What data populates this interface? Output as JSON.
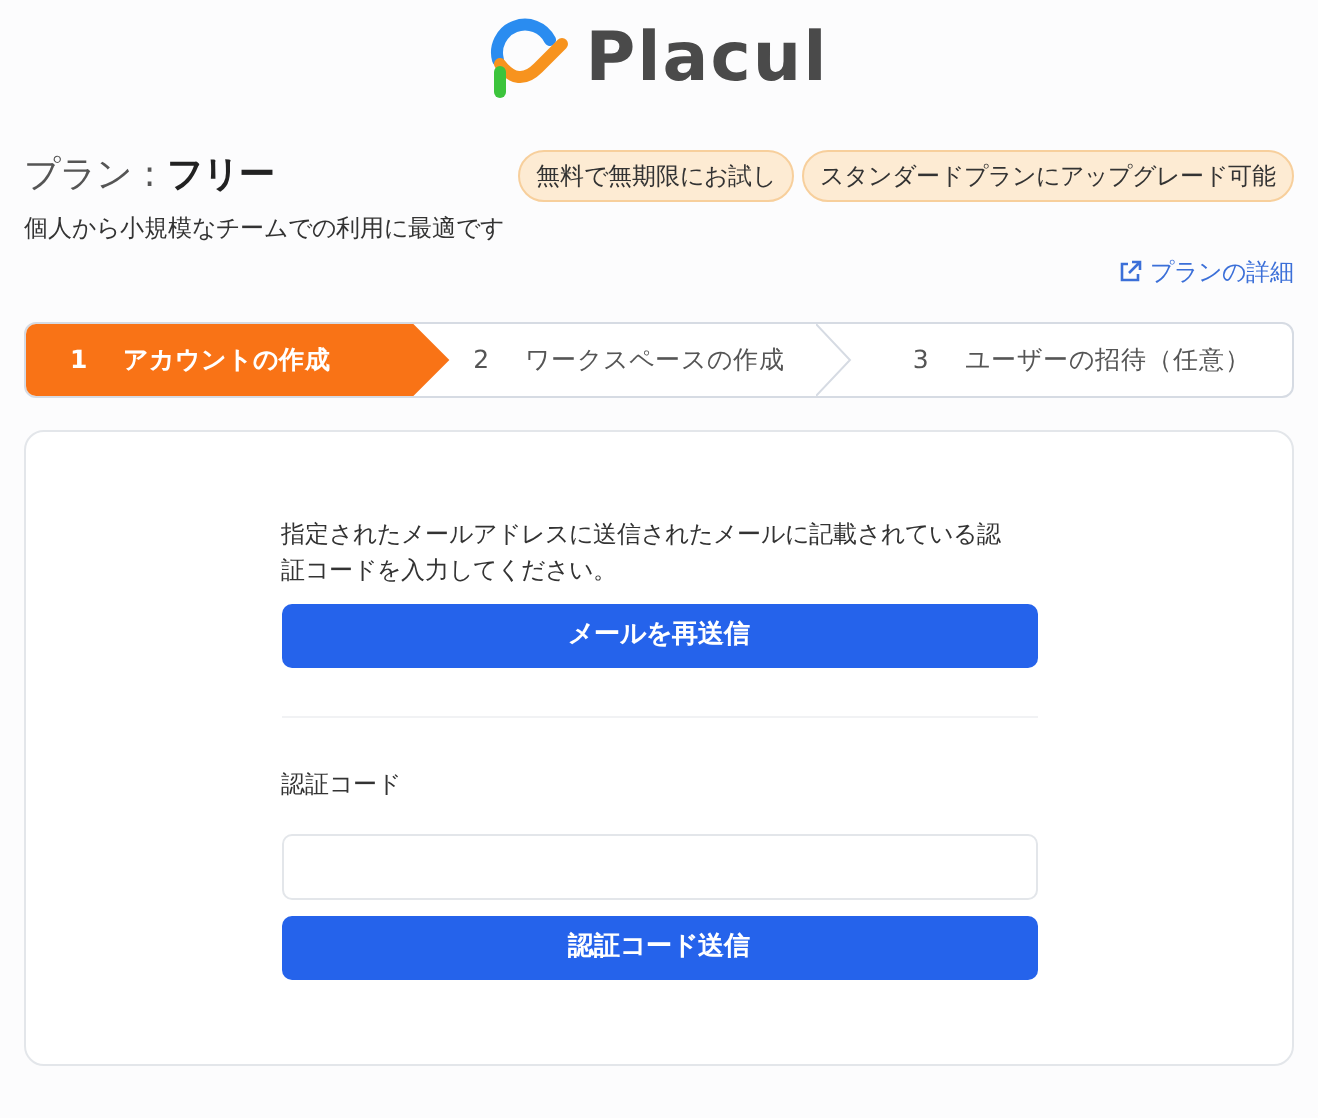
{
  "logo": {
    "text": "Placul"
  },
  "plan": {
    "title": "プラン : **フリー**",
    "tags": [
      "無料で無期限にお試し",
      "スタンダードプランにアップグレード可能"
    ],
    "description": "個人から小規模なチームでの利用に最適です",
    "details_link": "プランの詳細"
  },
  "steps": [
    {
      "number": "1",
      "label": "アカウントの作成",
      "selected": true
    },
    {
      "number": "2",
      "label": "ワークスペースの作成",
      "selected": false
    },
    {
      "number": "3",
      "label": "ユーザーの招待（任意）",
      "selected": false
    }
  ],
  "form": {
    "instructions": "指定されたメールアドレスに送信されたメールに記載されている認証コードを入力してください。",
    "resend_button": "メールを再送信",
    "code_label": "認証コード",
    "submit_button": "認証コード送信"
  }
}
